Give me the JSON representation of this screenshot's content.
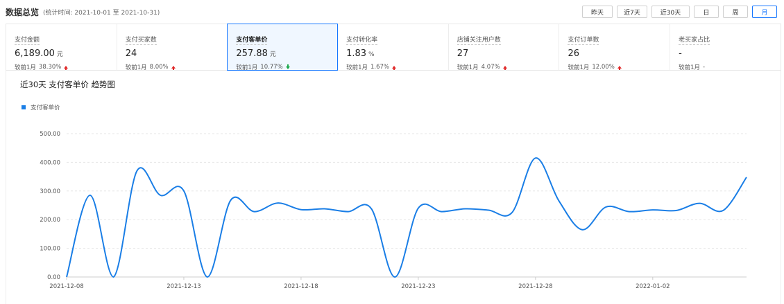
{
  "header": {
    "title": "数据总览",
    "period_label": "(统计时间:",
    "period_start": "2021-10-01",
    "period_sep": "至",
    "period_end": "2021-10-31)",
    "range_buttons": [
      "昨天",
      "近7天",
      "近30天",
      "日",
      "周",
      "月"
    ],
    "active_range": "月"
  },
  "metrics": [
    {
      "label": "支付金额",
      "value": "6,189.00",
      "unit": "元",
      "compare_label": "较前1月",
      "compare_value": "38.30%",
      "trend": "up"
    },
    {
      "label": "支付买家数",
      "value": "24",
      "unit": "",
      "compare_label": "较前1月",
      "compare_value": "8.00%",
      "trend": "up"
    },
    {
      "label": "支付客单价",
      "value": "257.88",
      "unit": "元",
      "compare_label": "较前1月",
      "compare_value": "10.77%",
      "trend": "down",
      "active": true
    },
    {
      "label": "支付转化率",
      "value": "1.83",
      "unit": "%",
      "compare_label": "较前1月",
      "compare_value": "1.67%",
      "trend": "up"
    },
    {
      "label": "店铺关注用户数",
      "value": "27",
      "unit": "",
      "compare_label": "较前1月",
      "compare_value": "4.07%",
      "trend": "up"
    },
    {
      "label": "支付订单数",
      "value": "26",
      "unit": "",
      "compare_label": "较前1月",
      "compare_value": "12.00%",
      "trend": "up"
    },
    {
      "label": "老买家占比",
      "value": "-",
      "unit": "",
      "compare_label": "较前1月",
      "compare_value": "-",
      "trend": "none"
    }
  ],
  "chart": {
    "title": "近30天 支付客单价 趋势图",
    "legend": "支付客单价",
    "color": "#1a7ee6"
  },
  "chart_data": {
    "type": "line",
    "title": "近30天 支付客单价 趋势图",
    "xlabel": "",
    "ylabel": "",
    "ylim": [
      0,
      500
    ],
    "yticks": [
      "0.00",
      "100.00",
      "200.00",
      "300.00",
      "400.00",
      "500.00"
    ],
    "xticks": [
      "2021-12-08",
      "2021-12-13",
      "2021-12-18",
      "2021-12-23",
      "2021-12-28",
      "2022-01-02"
    ],
    "grid": true,
    "legend_position": "top-left",
    "x": [
      "2021-12-08",
      "2021-12-09",
      "2021-12-10",
      "2021-12-11",
      "2021-12-12",
      "2021-12-13",
      "2021-12-14",
      "2021-12-15",
      "2021-12-16",
      "2021-12-17",
      "2021-12-18",
      "2021-12-19",
      "2021-12-20",
      "2021-12-21",
      "2021-12-22",
      "2021-12-23",
      "2021-12-24",
      "2021-12-25",
      "2021-12-26",
      "2021-12-27",
      "2021-12-28",
      "2021-12-29",
      "2021-12-30",
      "2021-12-31",
      "2022-01-01",
      "2022-01-02",
      "2022-01-03",
      "2022-01-04",
      "2022-01-05",
      "2022-01-06"
    ],
    "series": [
      {
        "name": "支付客单价",
        "values": [
          0,
          285,
          0,
          370,
          285,
          300,
          0,
          268,
          228,
          258,
          235,
          238,
          228,
          238,
          0,
          240,
          228,
          238,
          233,
          225,
          415,
          265,
          165,
          244,
          228,
          234,
          232,
          257,
          232,
          348
        ]
      }
    ]
  }
}
